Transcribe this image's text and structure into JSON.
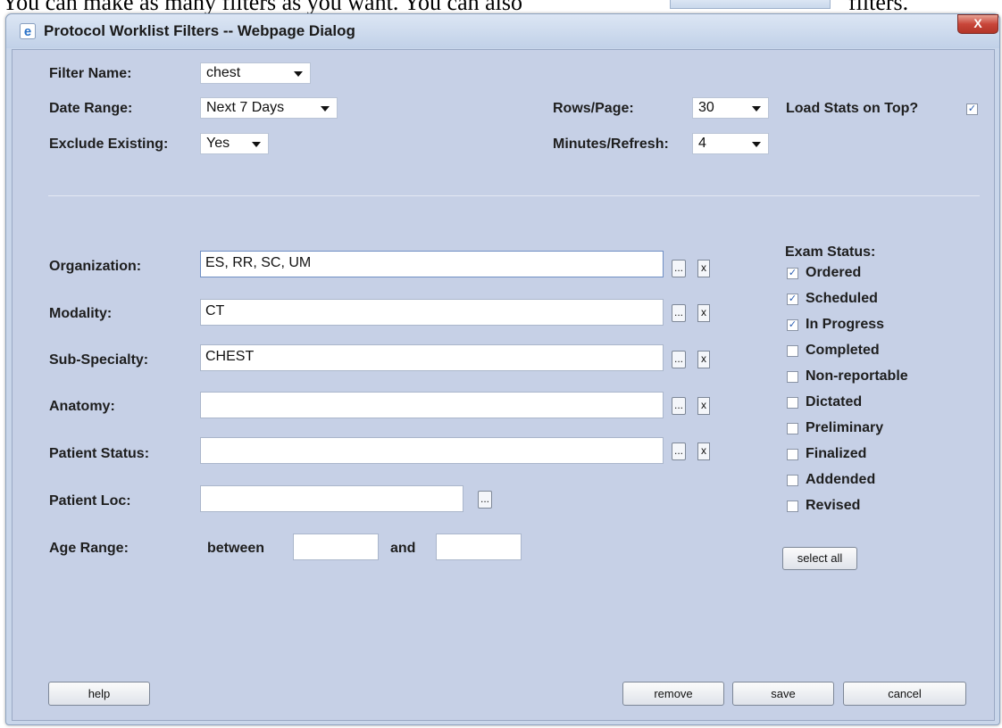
{
  "document": {
    "line_left": "You can make as many filters as you want.  You can also",
    "line_right": "filters."
  },
  "dialog": {
    "title": "Protocol Worklist Filters -- Webpage Dialog",
    "close_label": "X"
  },
  "filters": {
    "filter_name_label": "Filter Name:",
    "filter_name_value": "chest",
    "date_range_label": "Date Range:",
    "date_range_value": "Next 7 Days",
    "exclude_existing_label": "Exclude Existing:",
    "exclude_existing_value": "Yes",
    "rows_page_label": "Rows/Page:",
    "rows_page_value": "30",
    "minutes_refresh_label": "Minutes/Refresh:",
    "minutes_refresh_value": "4",
    "load_stats_label": "Load Stats on Top?",
    "load_stats_checked": true
  },
  "fields": {
    "organization_label": "Organization:",
    "organization_value": "ES, RR, SC, UM",
    "modality_label": "Modality:",
    "modality_value": "CT",
    "subspecialty_label": "Sub-Specialty:",
    "subspecialty_value": "CHEST",
    "anatomy_label": "Anatomy:",
    "anatomy_value": "",
    "patient_status_label": "Patient Status:",
    "patient_status_value": "",
    "patient_loc_label": "Patient Loc:",
    "patient_loc_value": "",
    "age_range_label": "Age Range:",
    "between_label": "between",
    "and_label": "and",
    "age_min": "",
    "age_max": "",
    "ellipsis_label": "...",
    "clear_label": "x"
  },
  "exam_status": {
    "heading": "Exam Status:",
    "items": [
      {
        "label": "Ordered",
        "checked": true
      },
      {
        "label": "Scheduled",
        "checked": true
      },
      {
        "label": "In Progress",
        "checked": true
      },
      {
        "label": "Completed",
        "checked": false
      },
      {
        "label": "Non-reportable",
        "checked": false
      },
      {
        "label": "Dictated",
        "checked": false
      },
      {
        "label": "Preliminary",
        "checked": false
      },
      {
        "label": "Finalized",
        "checked": false
      },
      {
        "label": "Addended",
        "checked": false
      },
      {
        "label": "Revised",
        "checked": false
      }
    ],
    "select_all_label": "select all"
  },
  "footer": {
    "help_label": "help",
    "remove_label": "remove",
    "save_label": "save",
    "cancel_label": "cancel"
  }
}
